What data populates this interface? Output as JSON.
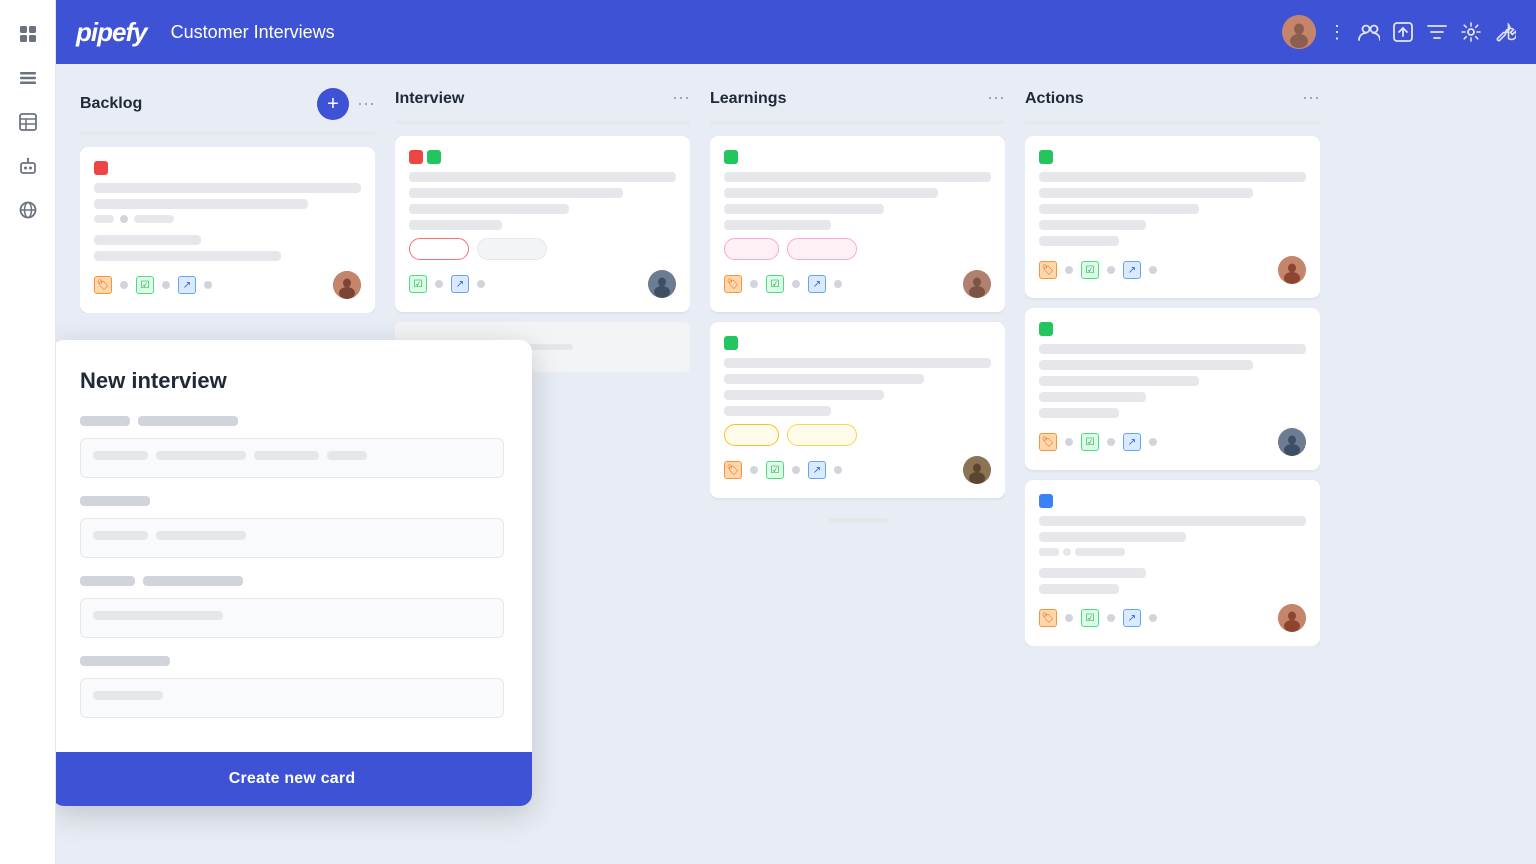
{
  "sidebar": {
    "icons": [
      "grid",
      "list",
      "table",
      "bot",
      "globe"
    ]
  },
  "header": {
    "logo": "pipefy",
    "title": "Customer Interviews",
    "actions": [
      "users-icon",
      "export-icon",
      "filter-icon",
      "settings-icon",
      "tools-icon",
      "more-icon"
    ]
  },
  "board": {
    "columns": [
      {
        "id": "backlog",
        "title": "Backlog",
        "showAdd": true,
        "cards": [
          {
            "id": "card-b1",
            "tags": [
              "red"
            ],
            "lines": [
              "full",
              "medium",
              "short-dot",
              "tiny",
              "medium",
              "short"
            ],
            "badges": [],
            "avatarFace": "face-1"
          }
        ]
      },
      {
        "id": "interview",
        "title": "Interview",
        "showAdd": false,
        "cards": [
          {
            "id": "card-i1",
            "tags": [
              "red",
              "green"
            ],
            "lines": [
              "full",
              "medium",
              "short",
              "tiny",
              "short"
            ],
            "badgesOutline": [
              "outline-red",
              "outline-gray"
            ],
            "avatarFace": "face-2"
          }
        ]
      },
      {
        "id": "learnings",
        "title": "Learnings",
        "showAdd": false,
        "cards": [
          {
            "id": "card-l1",
            "tags": [
              "green"
            ],
            "lines": [
              "full",
              "medium",
              "short",
              "tiny"
            ],
            "badgesOutline": [
              "outline-pink",
              "outline-pink-light"
            ],
            "avatarFace": "face-3"
          },
          {
            "id": "card-l2",
            "tags": [
              "green"
            ],
            "lines": [
              "full",
              "medium-2",
              "short",
              "tiny"
            ],
            "badgesOutline": [
              "outline-orange",
              "outline-amber"
            ],
            "avatarFace": "face-6"
          }
        ]
      },
      {
        "id": "actions",
        "title": "Actions",
        "showAdd": false,
        "cards": [
          {
            "id": "card-a1",
            "tags": [
              "green"
            ],
            "lines": [
              "full",
              "medium",
              "short",
              "tiny",
              "tiny2"
            ],
            "badges": [],
            "avatarFace": "face-4"
          },
          {
            "id": "card-a2",
            "tags": [
              "green"
            ],
            "lines": [
              "full",
              "medium",
              "short",
              "tiny",
              "tiny2"
            ],
            "badges": [],
            "avatarFace": "face-5"
          },
          {
            "id": "card-a3",
            "tags": [
              "blue"
            ],
            "lines": [
              "full",
              "medium",
              "short",
              "tiny",
              "tiny2"
            ],
            "badges": [],
            "avatarFace": "face-7"
          }
        ]
      }
    ]
  },
  "modal": {
    "title": "New interview",
    "form": {
      "field1": {
        "label1_width": "50px",
        "label2_width": "100px",
        "placeholder_parts": [
          "60px",
          "110px",
          "80px",
          "50px"
        ]
      },
      "field2": {
        "label_width": "70px",
        "placeholder_parts": [
          "55px",
          "90px"
        ]
      },
      "field3": {
        "label1_width": "55px",
        "label2_width": "100px",
        "placeholder_parts": [
          "130px"
        ]
      },
      "field4": {
        "label_width": "90px",
        "placeholder_parts": [
          "70px"
        ]
      }
    },
    "cta": "Create new card"
  }
}
